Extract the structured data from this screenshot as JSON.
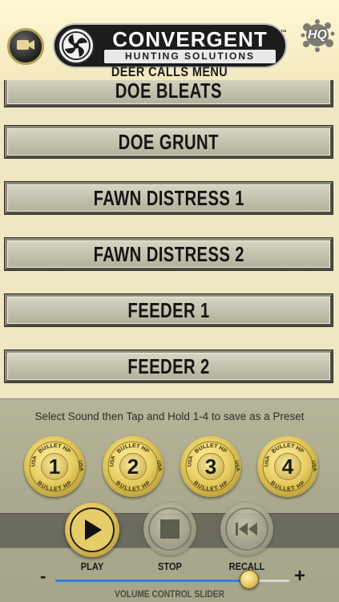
{
  "header": {
    "brand": "CONVERGENT",
    "brand_sub": "HUNTING SOLUTIONS",
    "trademark": "™",
    "hq_badge": "HQ",
    "menu_title": "DEER CALLS MENU",
    "icons": [
      "camera-icon",
      "fan-logo-icon"
    ]
  },
  "calls": [
    "DOE BLEATS",
    "DOE GRUNT",
    "FAWN DISTRESS 1",
    "FAWN DISTRESS 2",
    "FEEDER 1",
    "FEEDER 2"
  ],
  "controls": {
    "hint": "Select Sound then Tap and Hold 1-4 to save as a Preset",
    "presets": [
      {
        "number": "1",
        "ring_top": "BULLET HP",
        "ring_bottom": "BULLET HP",
        "ring_left": "USA",
        "ring_right": "USA"
      },
      {
        "number": "2",
        "ring_top": "BULLET HP",
        "ring_bottom": "BULLET HP",
        "ring_left": "USA",
        "ring_right": "USA"
      },
      {
        "number": "3",
        "ring_top": "BULLET HP",
        "ring_bottom": "BULLET HP",
        "ring_left": "USA",
        "ring_right": "USA"
      },
      {
        "number": "4",
        "ring_top": "BULLET HP",
        "ring_bottom": "BULLET HP",
        "ring_left": "USA",
        "ring_right": "USA"
      }
    ],
    "play_label": "PLAY",
    "stop_label": "STOP",
    "recall_label": "RECALL",
    "volume": {
      "minus": "-",
      "plus": "+",
      "level": 0.83,
      "caption": "VOLUME CONTROL SLIDER"
    }
  },
  "colors": {
    "background": "#efe6c2",
    "button_face": "#c8c6b1",
    "brass": "#e1c35a",
    "slider_fill": "#2f7fe0"
  }
}
